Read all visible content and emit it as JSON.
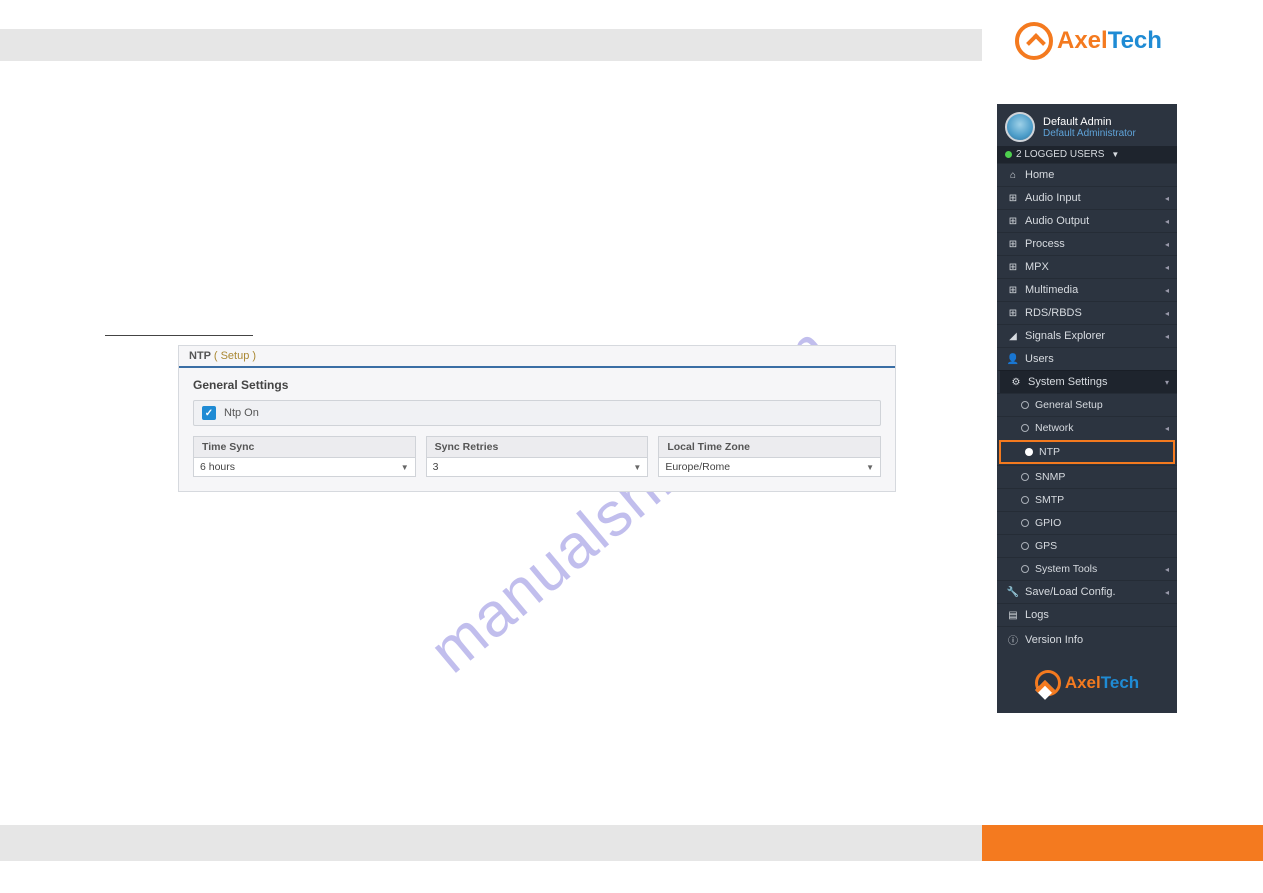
{
  "brand": {
    "axel": "Axel",
    "tech": "Tech"
  },
  "watermark": "manualshive.com",
  "sidebar": {
    "user": {
      "name": "Default Admin",
      "role": "Default Administrator"
    },
    "logged": "2 LOGGED USERS",
    "items": [
      {
        "icon": "⌂",
        "label": "Home",
        "expandable": false
      },
      {
        "icon": "⊞",
        "label": "Audio Input",
        "expandable": true
      },
      {
        "icon": "⊞",
        "label": "Audio Output",
        "expandable": true
      },
      {
        "icon": "⊞",
        "label": "Process",
        "expandable": true
      },
      {
        "icon": "⊞",
        "label": "MPX",
        "expandable": true
      },
      {
        "icon": "⊞",
        "label": "Multimedia",
        "expandable": true
      },
      {
        "icon": "⊞",
        "label": "RDS/RBDS",
        "expandable": true
      },
      {
        "icon": "◢",
        "label": "Signals Explorer",
        "expandable": true
      },
      {
        "icon": "👤",
        "label": "Users",
        "expandable": false
      },
      {
        "icon": "⚙",
        "label": "System Settings",
        "expandable": true,
        "open": true
      },
      {
        "icon": "🔧",
        "label": "Save/Load Config.",
        "expandable": true
      },
      {
        "icon": "▤",
        "label": "Logs",
        "expandable": false
      },
      {
        "icon": "ⓘ",
        "label": "Version Info",
        "expandable": false
      }
    ],
    "system_sub": [
      {
        "label": "General Setup"
      },
      {
        "label": "Network",
        "expandable": true
      },
      {
        "label": "NTP",
        "active": true
      },
      {
        "label": "SNMP"
      },
      {
        "label": "SMTP"
      },
      {
        "label": "GPIO"
      },
      {
        "label": "GPS"
      },
      {
        "label": "System Tools",
        "expandable": true
      }
    ]
  },
  "ntp": {
    "title": "NTP",
    "setup": "( Setup )",
    "section": "General Settings",
    "ntp_on_label": "Ntp On",
    "fields": [
      {
        "label": "Time Sync",
        "value": "6 hours"
      },
      {
        "label": "Sync Retries",
        "value": "3"
      },
      {
        "label": "Local Time Zone",
        "value": "Europe/Rome"
      }
    ]
  }
}
